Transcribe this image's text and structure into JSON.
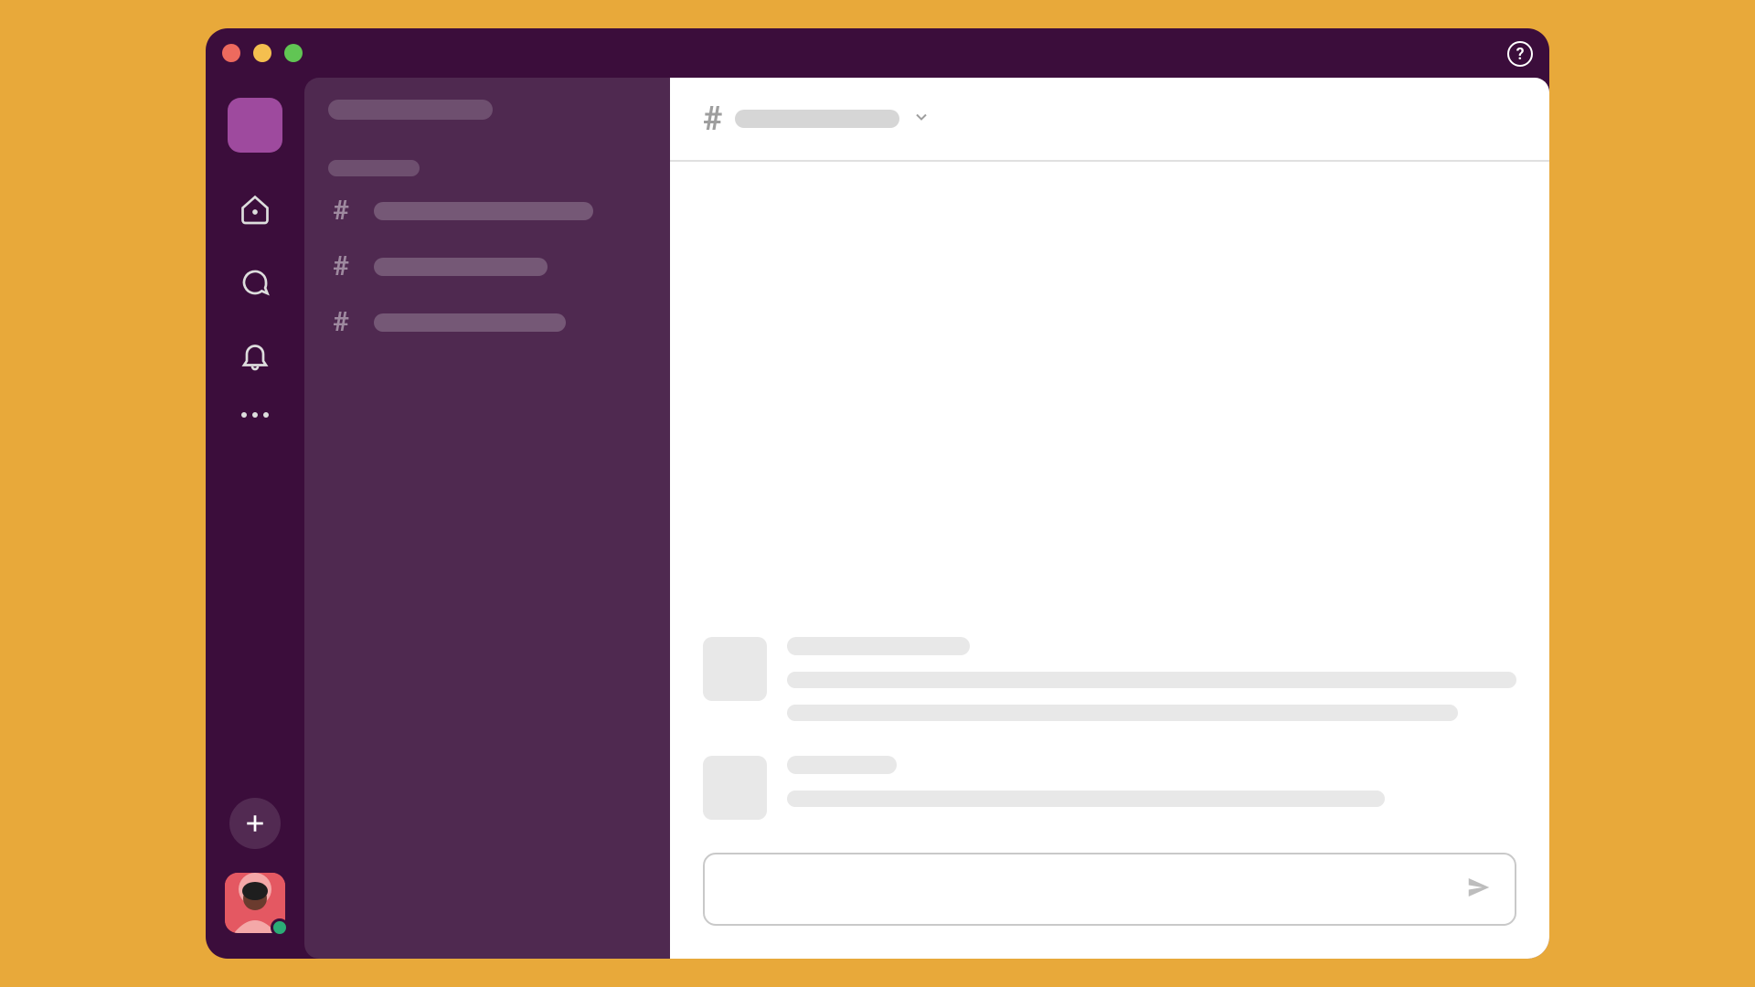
{
  "colors": {
    "page_bg": "#E8A93A",
    "window_bg": "#3B0D3B",
    "sidebar_bg": "#4F2950",
    "main_bg": "#FFFFFF",
    "workspace_accent": "#9E4A9E",
    "presence_active": "#2BAC76",
    "avatar_bg": "#E45862"
  },
  "titlebar": {
    "help_label": "?",
    "traffic_lights": [
      "close",
      "minimize",
      "maximize"
    ]
  },
  "rail": {
    "workspace_name": "",
    "nav_items": [
      {
        "id": "home",
        "icon": "home-icon"
      },
      {
        "id": "dms",
        "icon": "chat-icon"
      },
      {
        "id": "activity",
        "icon": "bell-icon"
      },
      {
        "id": "more",
        "icon": "more-icon"
      }
    ],
    "add_label": "",
    "user": {
      "name": "",
      "presence": "active"
    }
  },
  "sidebar": {
    "workspace_title": "",
    "section_label": "",
    "channels": [
      {
        "name": "",
        "placeholder_width": 240
      },
      {
        "name": "",
        "placeholder_width": 190
      },
      {
        "name": "",
        "placeholder_width": 210
      }
    ]
  },
  "main": {
    "header": {
      "channel_prefix": "#",
      "channel_name": ""
    },
    "messages": [
      {
        "author": "",
        "lines": [
          {
            "width_pct": 100
          },
          {
            "width_pct": 92
          }
        ]
      },
      {
        "author": "",
        "lines": [
          {
            "width_pct": 82
          }
        ]
      }
    ],
    "composer": {
      "placeholder": "",
      "value": ""
    }
  }
}
